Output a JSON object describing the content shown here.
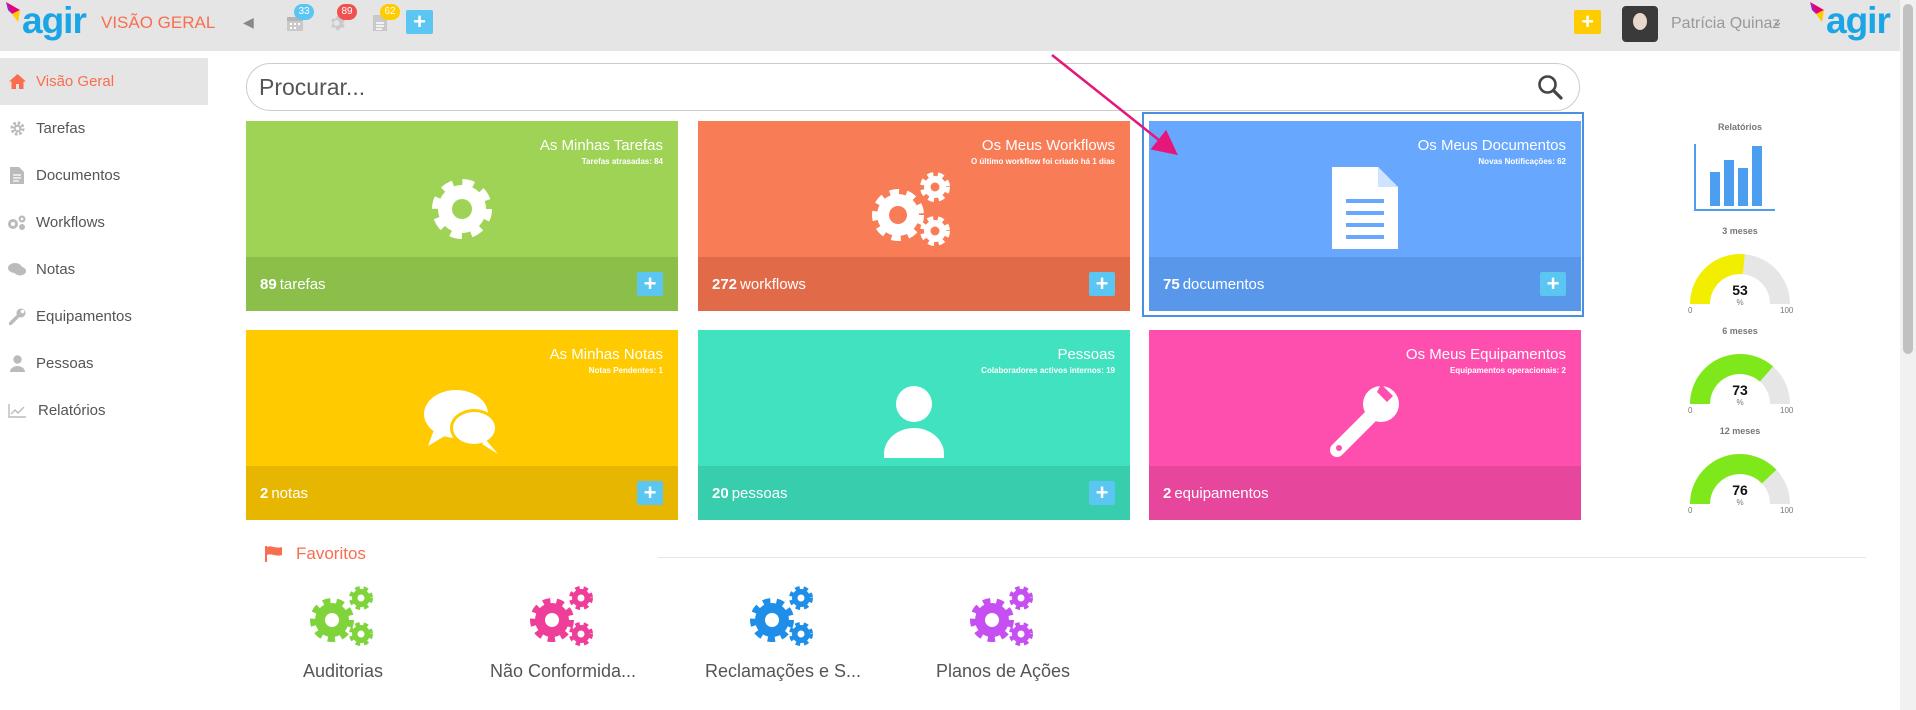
{
  "topbar": {
    "logo_text": "agir",
    "section_title": "VISÃO GERAL",
    "badges": {
      "calendar": "33",
      "tasks": "89",
      "docs": "62"
    },
    "user_name": "Patrícia Quinaz",
    "logo_right_text": "agir"
  },
  "sidebar": {
    "items": [
      {
        "label": "Visão Geral",
        "icon": "home-icon",
        "active": true
      },
      {
        "label": "Tarefas",
        "icon": "gear-icon"
      },
      {
        "label": "Documentos",
        "icon": "document-icon"
      },
      {
        "label": "Workflows",
        "icon": "gears-icon"
      },
      {
        "label": "Notas",
        "icon": "comments-icon"
      },
      {
        "label": "Equipamentos",
        "icon": "wrench-icon"
      },
      {
        "label": "Pessoas",
        "icon": "user-icon"
      },
      {
        "label": "Relatórios",
        "icon": "line-chart-icon"
      }
    ]
  },
  "search": {
    "placeholder": "Procurar..."
  },
  "tiles": [
    {
      "title": "As Minhas Tarefas",
      "subtitle": "Tarefas atrasadas: 84",
      "count": "89",
      "unit": "tarefas",
      "color": "#9fd356",
      "foot": "#8bbf4a"
    },
    {
      "title": "Os Meus Workflows",
      "subtitle": "O último workflow foi criado há 1 dias",
      "count": "272",
      "unit": "workflows",
      "color": "#f87c56",
      "foot": "#e16b48"
    },
    {
      "title": "Os Meus Documentos",
      "subtitle": "Novas Notificações: 62",
      "count": "75",
      "unit": "documentos",
      "color": "#67a8fe",
      "foot": "#5997ea"
    },
    {
      "title": "As Minhas Notas",
      "subtitle": "Notas Pendentes: 1",
      "count": "2",
      "unit": "notas",
      "color": "#ffcb00",
      "foot": "#e6b600"
    },
    {
      "title": "Pessoas",
      "subtitle": "Colaboradores activos internos: 19",
      "count": "20",
      "unit": "pessoas",
      "color": "#41e2bf",
      "foot": "#37cdad"
    },
    {
      "title": "Os Meus Equipamentos",
      "subtitle": "Equipamentos operacionais: 2",
      "count": "2",
      "unit": "equipamentos",
      "color": "#ff4fae",
      "foot": "#e7469d"
    }
  ],
  "reports": {
    "title": "Relatórios",
    "gauges": [
      {
        "label": "3 meses",
        "value": 53,
        "unit": "%",
        "min": "0",
        "max": "100",
        "color": "#f3ee00"
      },
      {
        "label": "6 meses",
        "value": 73,
        "unit": "%",
        "min": "0",
        "max": "100",
        "color": "#7fe81a"
      },
      {
        "label": "12 meses",
        "value": 76,
        "unit": "%",
        "min": "0",
        "max": "100",
        "color": "#7fe81a"
      }
    ]
  },
  "favorites": {
    "title": "Favoritos",
    "items": [
      {
        "label": "Auditorias",
        "color": "#7fd33b"
      },
      {
        "label": "Não Conformida...",
        "color": "#ee3e9a"
      },
      {
        "label": "Reclamações e S...",
        "color": "#1e8ee9"
      },
      {
        "label": "Planos de Ações",
        "color": "#c54ff0"
      }
    ]
  }
}
